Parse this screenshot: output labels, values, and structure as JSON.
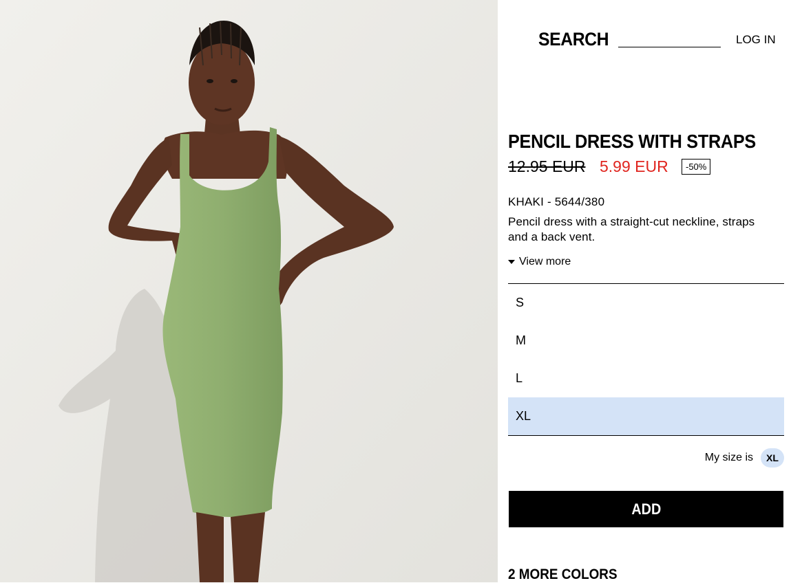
{
  "header": {
    "search_label": "SEARCH",
    "search_placeholder": "",
    "login_label": "LOG IN"
  },
  "product": {
    "title": "PENCIL DRESS WITH STRAPS",
    "old_price": "12.95 EUR",
    "new_price": "5.99 EUR",
    "discount": "-50%",
    "reference": "KHAKI - 5644/380",
    "description": "Pencil dress with a straight-cut neckline, straps and a back vent.",
    "view_more_label": "View more",
    "image_alt": "Model wearing khaki pencil dress with straps"
  },
  "sizes": {
    "options": [
      "S",
      "M",
      "L",
      "XL"
    ],
    "selected": "XL",
    "my_size_label": "My size is",
    "my_size_value": "XL"
  },
  "actions": {
    "add_label": "ADD"
  },
  "colors": {
    "more_colors_label": "2 MORE COLORS"
  },
  "theme": {
    "price_sale_color": "#e0251f",
    "selected_size_bg": "#d4e3f7",
    "dress_color": "#8fae6f"
  }
}
